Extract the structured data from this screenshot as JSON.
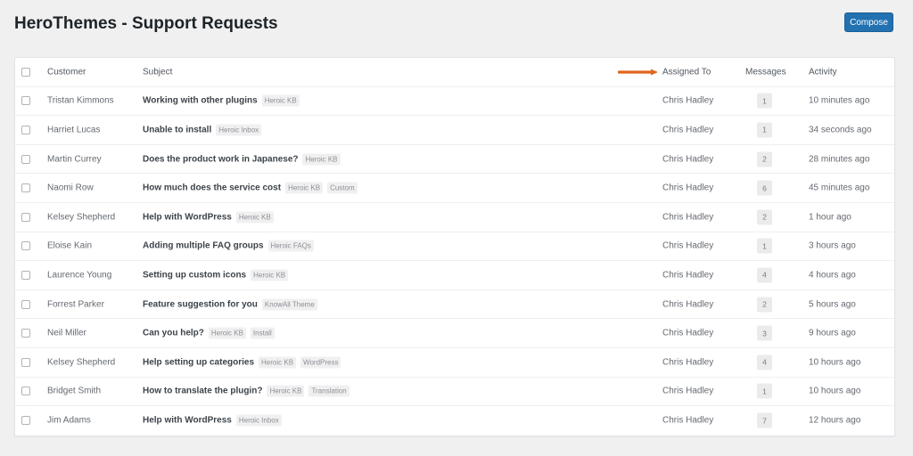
{
  "page": {
    "title": "HeroThemes - Support Requests",
    "compose_label": "Compose",
    "accent_color": "#2271b1",
    "arrow_color": "#e0661c"
  },
  "table": {
    "headers": {
      "customer": "Customer",
      "subject": "Subject",
      "assigned_to": "Assigned To",
      "messages": "Messages",
      "activity": "Activity"
    },
    "rows": [
      {
        "customer": "Tristan Kimmons",
        "subject": "Working with other plugins",
        "tags": [
          "Heroic KB"
        ],
        "assigned": "Chris Hadley",
        "messages": "1",
        "activity": "10 minutes ago"
      },
      {
        "customer": "Harriet Lucas",
        "subject": "Unable to install",
        "tags": [
          "Heroic Inbox"
        ],
        "assigned": "Chris Hadley",
        "messages": "1",
        "activity": "34 seconds ago"
      },
      {
        "customer": "Martin Currey",
        "subject": "Does the product work in Japanese?",
        "tags": [
          "Heroic KB"
        ],
        "assigned": "Chris Hadley",
        "messages": "2",
        "activity": "28 minutes ago"
      },
      {
        "customer": "Naomi Row",
        "subject": "How much does the service cost",
        "tags": [
          "Heroic KB",
          "Custom"
        ],
        "assigned": "Chris Hadley",
        "messages": "6",
        "activity": "45 minutes ago"
      },
      {
        "customer": "Kelsey Shepherd",
        "subject": "Help with WordPress",
        "tags": [
          "Heroic KB"
        ],
        "assigned": "Chris Hadley",
        "messages": "2",
        "activity": "1 hour ago"
      },
      {
        "customer": "Eloise Kain",
        "subject": "Adding multiple FAQ groups",
        "tags": [
          "Heroic FAQs"
        ],
        "assigned": "Chris Hadley",
        "messages": "1",
        "activity": "3 hours ago"
      },
      {
        "customer": "Laurence Young",
        "subject": "Setting up custom icons",
        "tags": [
          "Heroic KB"
        ],
        "assigned": "Chris Hadley",
        "messages": "4",
        "activity": "4 hours ago"
      },
      {
        "customer": "Forrest Parker",
        "subject": "Feature suggestion for you",
        "tags": [
          "KnowAll Theme"
        ],
        "assigned": "Chris Hadley",
        "messages": "2",
        "activity": "5 hours ago"
      },
      {
        "customer": "Neil Miller",
        "subject": "Can you help?",
        "tags": [
          "Heroic KB",
          "Install"
        ],
        "assigned": "Chris Hadley",
        "messages": "3",
        "activity": "9 hours ago"
      },
      {
        "customer": "Kelsey Shepherd",
        "subject": "Help setting up categories",
        "tags": [
          "Heroic KB",
          "WordPress"
        ],
        "assigned": "Chris Hadley",
        "messages": "4",
        "activity": "10 hours ago"
      },
      {
        "customer": "Bridget Smith",
        "subject": "How to translate the plugin?",
        "tags": [
          "Heroic KB",
          "Translation"
        ],
        "assigned": "Chris Hadley",
        "messages": "1",
        "activity": "10 hours ago"
      },
      {
        "customer": "Jim Adams",
        "subject": "Help with WordPress",
        "tags": [
          "Heroic Inbox"
        ],
        "assigned": "Chris Hadley",
        "messages": "7",
        "activity": "12 hours ago"
      }
    ]
  }
}
